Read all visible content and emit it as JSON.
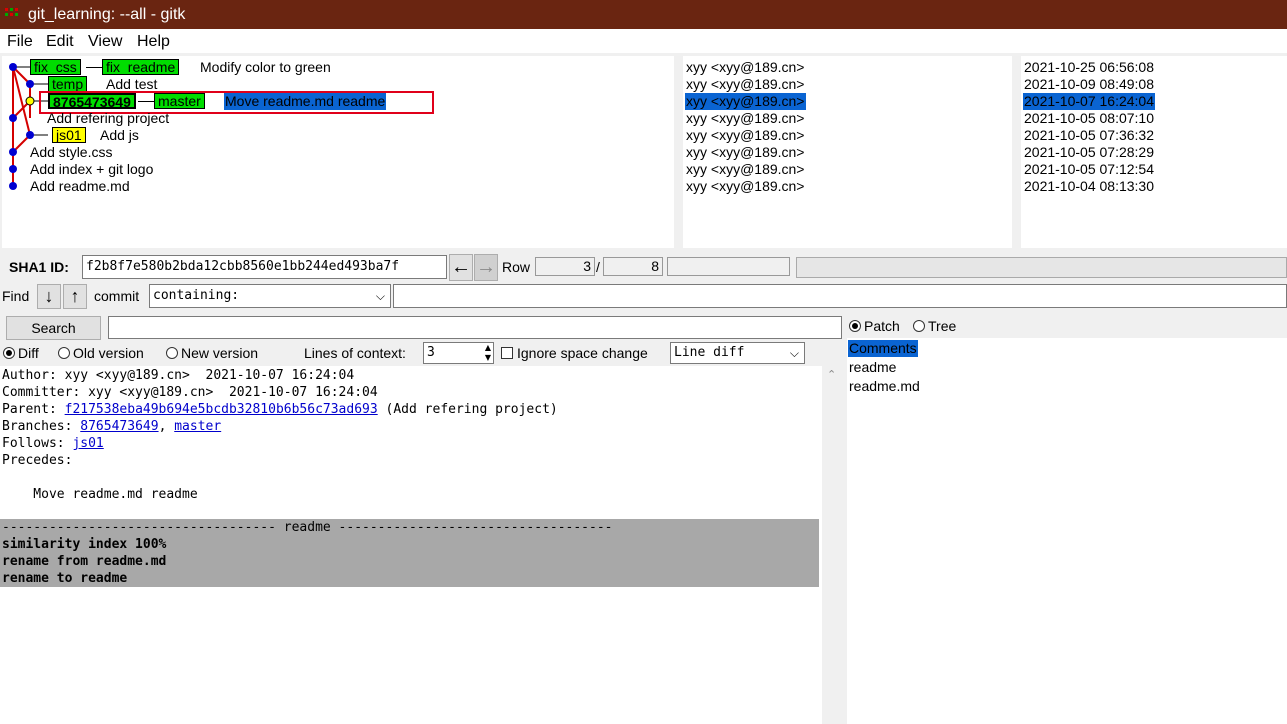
{
  "window": {
    "title": "git_learning: --all - gitk"
  },
  "menu": {
    "file": "File",
    "edit": "Edit",
    "view": "View",
    "help": "Help"
  },
  "commits": [
    {
      "tags": [
        "fix_css",
        "fix_readme"
      ],
      "message": "Modify color to green",
      "author": "xyy <xyy@189.cn>",
      "date": "2021-10-25 06:56:08"
    },
    {
      "tags": [
        "temp"
      ],
      "message": "Add test",
      "author": "xyy <xyy@189.cn>",
      "date": "2021-10-09 08:49:08"
    },
    {
      "tags": [
        "8765473649",
        "master"
      ],
      "message": "Move readme.md readme",
      "author": "xyy <xyy@189.cn>",
      "date": "2021-10-07 16:24:04"
    },
    {
      "tags": [],
      "message": "Add refering project",
      "author": "xyy <xyy@189.cn>",
      "date": "2021-10-05 08:07:10"
    },
    {
      "tags": [
        "js01"
      ],
      "message": "Add js",
      "author": "xyy <xyy@189.cn>",
      "date": "2021-10-05 07:36:32"
    },
    {
      "tags": [],
      "message": "Add style.css",
      "author": "xyy <xyy@189.cn>",
      "date": "2021-10-05 07:28:29"
    },
    {
      "tags": [],
      "message": "Add index + git logo",
      "author": "xyy <xyy@189.cn>",
      "date": "2021-10-05 07:12:54"
    },
    {
      "tags": [],
      "message": "Add readme.md",
      "author": "xyy <xyy@189.cn>",
      "date": "2021-10-04 08:13:30"
    }
  ],
  "sha": {
    "label": "SHA1 ID:",
    "value": "f2b8f7e580b2bda12cbb8560e1bb244ed493ba7f"
  },
  "nav": {
    "back_icon": "←",
    "forward_icon": "→"
  },
  "row": {
    "label": "Row",
    "current": "3",
    "separator": "/",
    "total": "8"
  },
  "find": {
    "label": "Find",
    "down_icon": "↓",
    "up_icon": "↑",
    "type": "commit",
    "mode": "containing:"
  },
  "search": {
    "button": "Search"
  },
  "diff_options": {
    "diff": "Diff",
    "old": "Old version",
    "new": "New version",
    "context_label": "Lines of context:",
    "context_value": "3",
    "ignore_space": "Ignore space change",
    "diff_mode": "Line diff"
  },
  "tree_options": {
    "patch": "Patch",
    "tree": "Tree"
  },
  "details": {
    "author": "Author: xyy <xyy@189.cn>  2021-10-07 16:24:04",
    "committer": "Committer: xyy <xyy@189.cn>  2021-10-07 16:24:04",
    "parent_label": "Parent: ",
    "parent_hash": "f217538eba49b694e5bcdb32810b6b56c73ad693",
    "parent_msg": " (Add refering project)",
    "branches_label": "Branches: ",
    "branch1": "8765473649",
    "branch_sep": ", ",
    "branch2": "master",
    "follows_label": "Follows: ",
    "follows": "js01",
    "precedes": "Precedes:",
    "message": "    Move readme.md readme",
    "diff_header": "----------------------------------- readme -----------------------------------",
    "diff1": "similarity index 100%",
    "diff2": "rename from readme.md",
    "diff3": "rename to readme"
  },
  "files": [
    "Comments",
    "readme",
    "readme.md"
  ],
  "colors": {
    "titlebar": "#6a2511",
    "selection": "#0a64d2",
    "tag_green": "#00dd00",
    "tag_yellow": "#ffff00",
    "graph_red": "#d40000",
    "graph_blue": "#0000d0",
    "highlight_box": "#e0001a"
  }
}
